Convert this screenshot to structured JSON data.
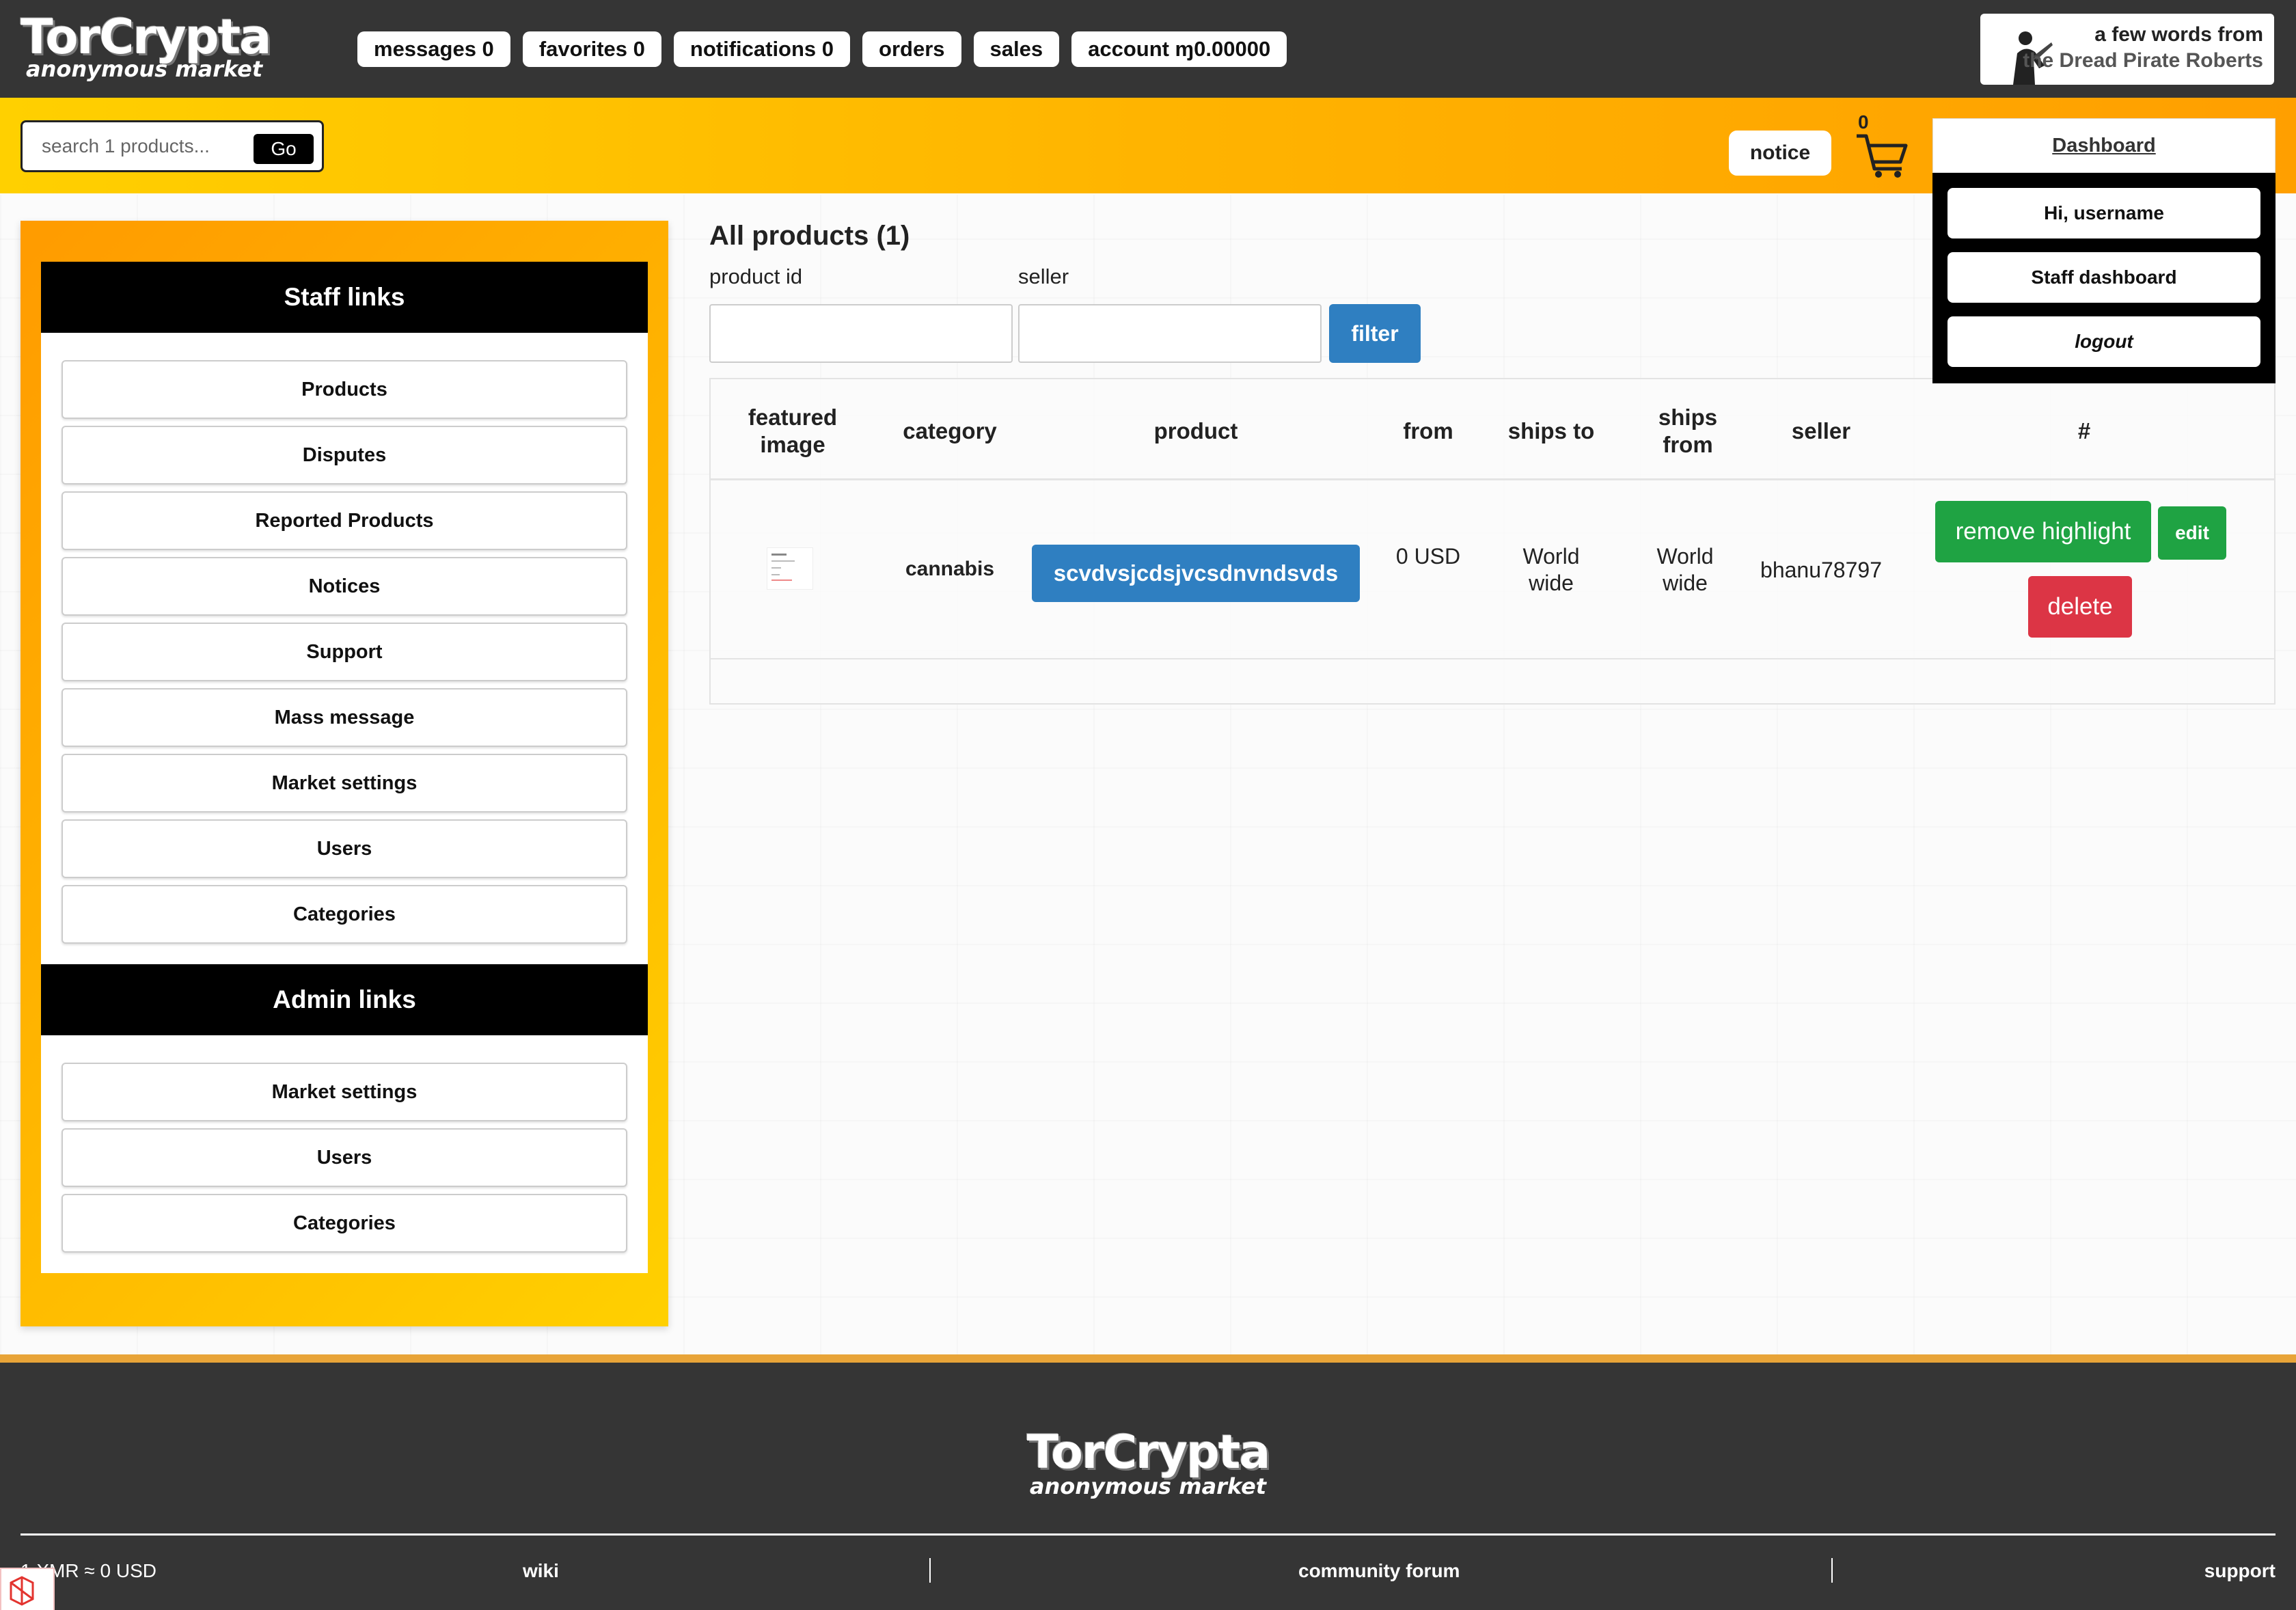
{
  "brand": {
    "name": "TorCrypta",
    "tagline": "anonymous market"
  },
  "topnav": {
    "messages": "messages 0",
    "favorites": "favorites 0",
    "notifications": "notifications 0",
    "orders": "orders",
    "sales": "sales",
    "account": "account ɱ0.00000"
  },
  "dpr": {
    "line1": "a few words from",
    "line2": "the Dread Pirate Roberts"
  },
  "search": {
    "placeholder": "search 1 products...",
    "go_label": "Go"
  },
  "notice_label": "notice",
  "cart_count": "0",
  "dashboard": {
    "title": "Dashboard",
    "items": [
      "Hi, username",
      "Staff dashboard",
      "logout"
    ]
  },
  "sidebar": {
    "staff_title": "Staff links",
    "staff_items": [
      "Products",
      "Disputes",
      "Reported Products",
      "Notices",
      "Support",
      "Mass message",
      "Market settings",
      "Users",
      "Categories"
    ],
    "admin_title": "Admin links",
    "admin_items": [
      "Market settings",
      "Users",
      "Categories"
    ]
  },
  "main": {
    "title": "All products (1)",
    "filter": {
      "product_id_label": "product id",
      "seller_label": "seller",
      "button": "filter"
    },
    "table": {
      "headers": {
        "featured_image": "featured image",
        "category": "category",
        "product": "product",
        "from": "from",
        "ships_to": "ships to",
        "ships_from": "ships from",
        "seller": "seller",
        "actions": "#"
      },
      "rows": [
        {
          "category": "cannabis",
          "product": "scvdvsjcdsjvcsdnvndsvds",
          "from": "0 USD",
          "ships_to": "World wide",
          "ships_from": "World wide",
          "seller": "bhanu78797",
          "remove_highlight": "remove highlight",
          "edit": "edit",
          "delete": "delete"
        }
      ]
    }
  },
  "footer": {
    "rate": "1 XMR ≈ 0 USD",
    "links": [
      "wiki",
      "community forum",
      "support"
    ]
  },
  "colors": {
    "accent": "#ffb400",
    "dark": "#353535",
    "primary": "#2f7fc1",
    "success": "#1fa343",
    "danger": "#dc3545"
  }
}
